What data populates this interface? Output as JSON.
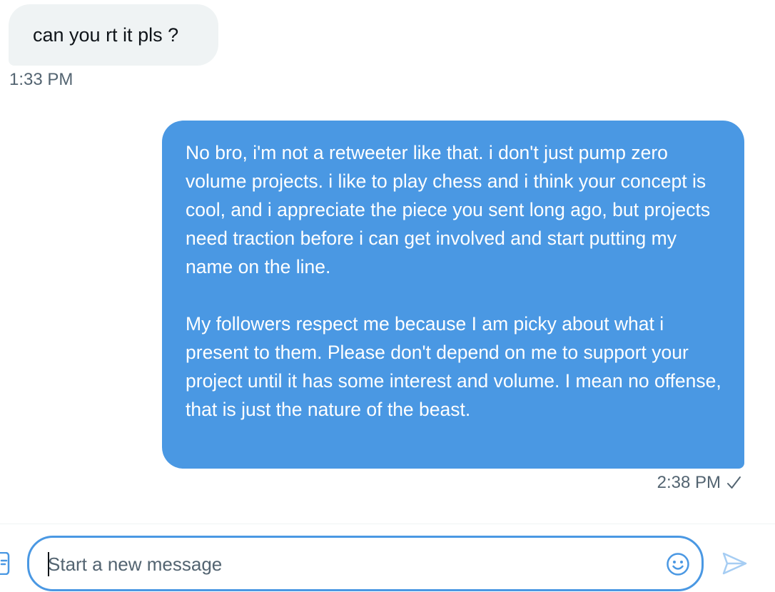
{
  "conversation": {
    "messages": [
      {
        "direction": "incoming",
        "text": "can you rt it pls ?",
        "time": "1:33 PM"
      },
      {
        "direction": "outgoing",
        "paragraphs": [
          "No bro, i'm not a retweeter like that. i don't just pump zero volume projects. i like to play chess and i think your concept is cool, and i appreciate the piece you sent long ago, but projects need traction before i can get involved and start putting my name on the line.",
          "My followers respect me because I am picky about what i present to them. Please don't depend on me to support your project until it has some interest and volume. I mean no offense, that is just the nature of the beast."
        ],
        "time": "2:38 PM",
        "status_icon": "check-icon"
      }
    ]
  },
  "composer": {
    "placeholder": "Start a new message",
    "value": "",
    "left_icon": "gif-icon",
    "emoji_icon": "emoji-icon",
    "send_icon": "send-icon"
  },
  "colors": {
    "accent": "#4a98e3",
    "incoming_bubble": "#eff3f4",
    "muted_text": "#536471"
  }
}
